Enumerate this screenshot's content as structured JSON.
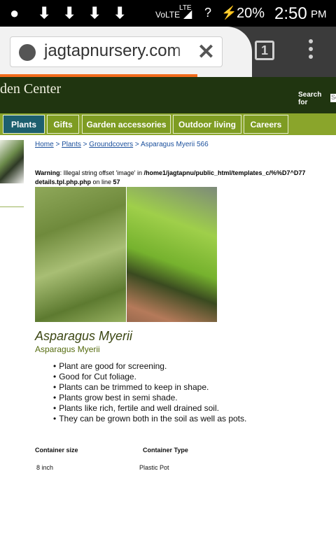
{
  "status_bar": {
    "network": "VoLTE",
    "lte": "LTE",
    "battery": "20%",
    "time": "2:50",
    "ampm": "PM"
  },
  "browser": {
    "url": "jagtapnursery.com",
    "tab_count": "1"
  },
  "site": {
    "title": "den Center",
    "search_label": "Search for",
    "search_placeholder": "Se"
  },
  "nav": {
    "items": [
      {
        "label": "Plants"
      },
      {
        "label": "Gifts"
      },
      {
        "label": "Garden accessories"
      },
      {
        "label": "Outdoor living"
      },
      {
        "label": "Careers"
      }
    ]
  },
  "breadcrumb": {
    "home": "Home",
    "sep": " > ",
    "plants": "Plants",
    "groundcovers": "Groundcovers",
    "current": " > Asparagus Myerii 566"
  },
  "warning": {
    "label": "Warning",
    "message": ": Illegal string offset 'image' in ",
    "path": "/home1/jagtapnu/public_html/templates_c/%%D7^D77",
    "file": "details.tpl.php.php",
    "line_text": " on line ",
    "line_no": "57"
  },
  "product": {
    "title": "Asparagus Myerii",
    "subtitle": "Asparagus Myerii",
    "features": [
      "Plant are good for screening.",
      "Good for Cut foliage.",
      "Plants can be trimmed to keep in shape.",
      "Plants grow best in semi shade.",
      "Plants like rich, fertile and well drained soil.",
      "They can be grown both in the soil as well as pots."
    ]
  },
  "specs": {
    "container_size_label": "Container size",
    "container_type_label": "Container Type",
    "container_size": "8 inch",
    "container_type": "Plastic Pot"
  }
}
